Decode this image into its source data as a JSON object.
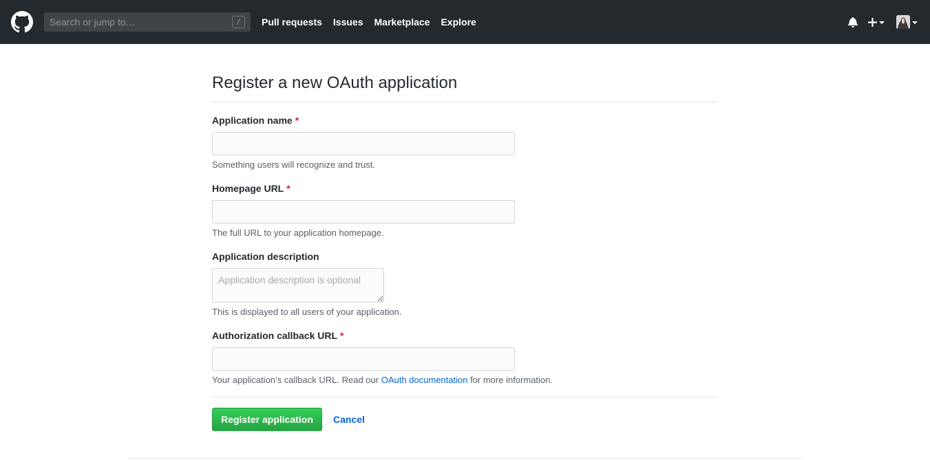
{
  "header": {
    "search_placeholder": "Search or jump to…",
    "search_shortcut": "/",
    "nav": [
      "Pull requests",
      "Issues",
      "Marketplace",
      "Explore"
    ],
    "plus_label": "+",
    "icons": [
      "github-logo-icon",
      "bell-icon",
      "plus-icon",
      "avatar"
    ]
  },
  "form": {
    "title": "Register a new OAuth application",
    "app_name": {
      "label": "Application name",
      "required_mark": "*",
      "value": "",
      "note": "Something users will recognize and trust."
    },
    "homepage": {
      "label": "Homepage URL",
      "required_mark": "*",
      "value": "",
      "note": "The full URL to your application homepage."
    },
    "description": {
      "label": "Application description",
      "placeholder": "Application description is optional",
      "value": "",
      "note": "This is displayed to all users of your application."
    },
    "callback": {
      "label": "Authorization callback URL",
      "required_mark": "*",
      "value": "",
      "note_before": "Your application’s callback URL. Read our ",
      "note_link": "OAuth documentation",
      "note_after": " for more information."
    },
    "submit_label": "Register application",
    "cancel_label": "Cancel"
  },
  "colors": {
    "header_bg": "#24292e",
    "primary_green": "#28a745",
    "link_blue": "#0366d6",
    "required_red": "#cb2431"
  }
}
